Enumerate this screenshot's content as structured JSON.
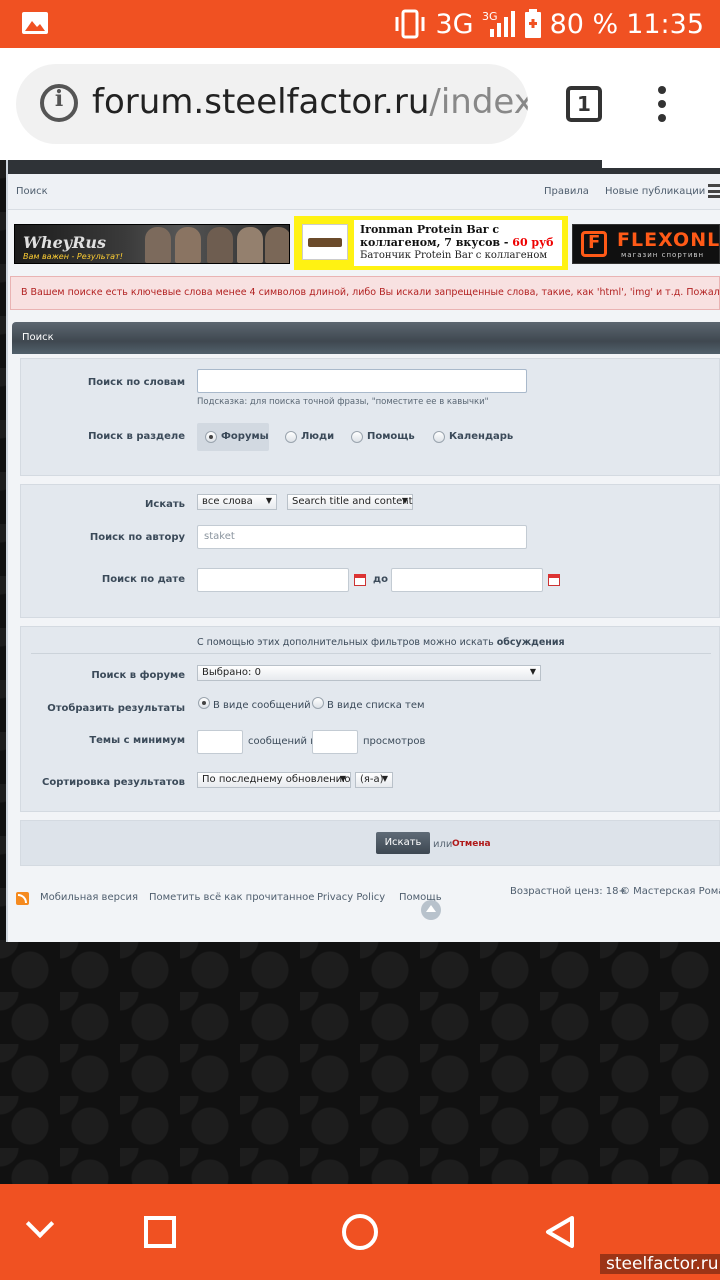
{
  "status_bar": {
    "network": "3G",
    "network_small": "3G",
    "battery": "80 %",
    "time": "11:35",
    "accent_color": "#f05122"
  },
  "browser": {
    "url_domain": "forum.steelfactor.ru",
    "url_path": "/index",
    "tab_count": "1",
    "icons": [
      "info-icon",
      "tabs-icon",
      "more-vert-icon"
    ]
  },
  "subnav": {
    "search": "Поиск",
    "rules": "Правила",
    "new_posts": "Новые публикации"
  },
  "banners": {
    "whey_title": "WheyRus",
    "whey_slogan": "Вам важен - Результат!",
    "iron_title": "Ironman Protein Bar с коллагеном, 7 вкусов -",
    "iron_price": "60 руб",
    "iron_sub": "Батончик Protein Bar с коллагеном",
    "flex_name": "FLEXONL",
    "flex_slogan": "магазин спортивн"
  },
  "error_text": "В Вашем поиске есть ключевые слова менее 4 символов длиной, либо Вы искали запрещенные слова, такие, как 'html', 'img' и т.д. Пожалуйста, изм",
  "panel_title": "Поиск",
  "form": {
    "keywords_label": "Поиск по словам",
    "keywords_value": "",
    "keywords_hint": "Подсказка: для поиска точной фразы, \"поместите ее в кавычки\"",
    "section_label": "Поиск в разделе",
    "sections": [
      "Форумы",
      "Люди",
      "Помощь",
      "Календарь"
    ],
    "find_label": "Искать",
    "find_select": "все слова",
    "scope_select": "Search title and content",
    "author_label": "Поиск по автору",
    "author_value": "staket",
    "date_label": "Поиск по дате",
    "date_to": "до",
    "filters_note": "С помощью этих дополнительных фильтров можно искать",
    "filters_note_bold": "обсуждения",
    "forum_label": "Поиск в форуме",
    "forum_select": "Выбрано: 0",
    "display_label": "Отобразить результаты",
    "display_posts": "В виде сообщений",
    "display_topics": "В виде списка тем",
    "min_label": "Темы с минимум",
    "min_posts": "сообщений и",
    "min_views": "просмотров",
    "sort_label": "Сортировка результатов",
    "sort_select": "По последнему обновлению",
    "order_select": "(я-а)",
    "submit": "Искать",
    "or": "или",
    "cancel": "Отмена"
  },
  "footer": {
    "mobile": "Мобильная версия",
    "mark_read": "Пометить всё как прочитанное",
    "privacy": "Privacy Policy",
    "help": "Помощь",
    "age": "Возрастной ценз: 18+",
    "copyright": "© Мастерская Роман"
  },
  "watermark": "steelfactor.ru"
}
